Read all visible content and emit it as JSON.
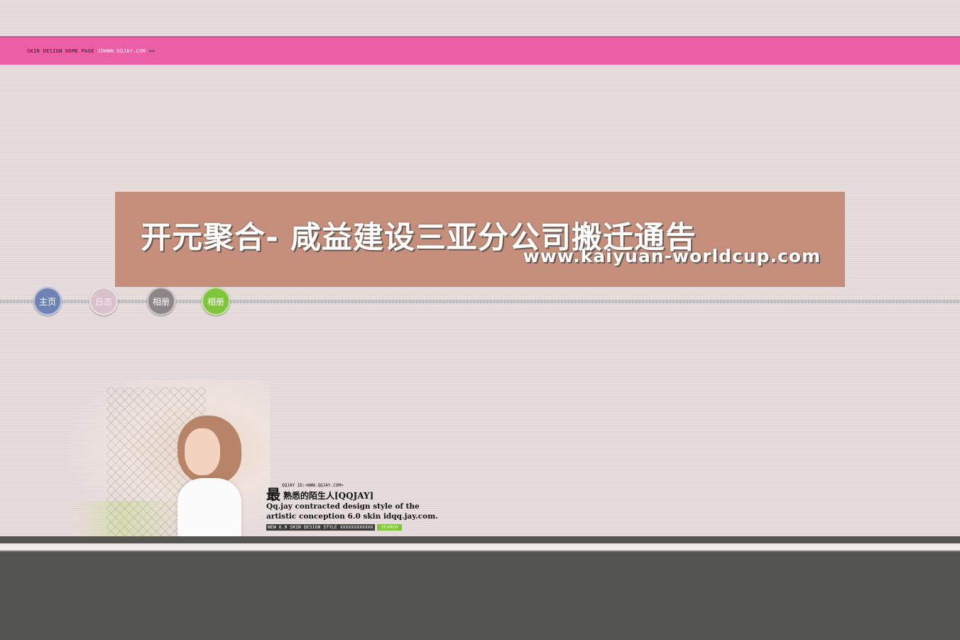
{
  "topbar": {
    "label": "SKIN DESIGN HOME PAGE",
    "link": "IDWWW.QQJAY.COM",
    "arrow": ">>"
  },
  "banner": {
    "title": "开元聚合- 咸益建设三亚分公司搬迁通告",
    "url": "www.kaiyuan-worldcup.com"
  },
  "nav": {
    "home": "主页",
    "blog": "日志",
    "album1": "相册",
    "album2": "相册"
  },
  "signature": {
    "big_char": "最",
    "small_id": "QQJAY ID:<WWW.QQJAY.COM>",
    "name": "熟悉的陌生人[QQJAY]",
    "desc": "Qq.jay contracted design style of the artistic conception 6.0 skin idqq.jay.com.",
    "style_label": "NEW 6.0 SKIN DESIGN STYLE xxxxxxxxxxxx",
    "search_label": "SEARCH"
  },
  "colors": {
    "topbar": "#ec5ea5",
    "banner": "#c58f7b",
    "nav_home": "#6e82b3",
    "nav_blog": "#d8c2cc",
    "nav_album1": "#8d8588",
    "nav_album2": "#7fc43a",
    "footer": "#545450"
  }
}
